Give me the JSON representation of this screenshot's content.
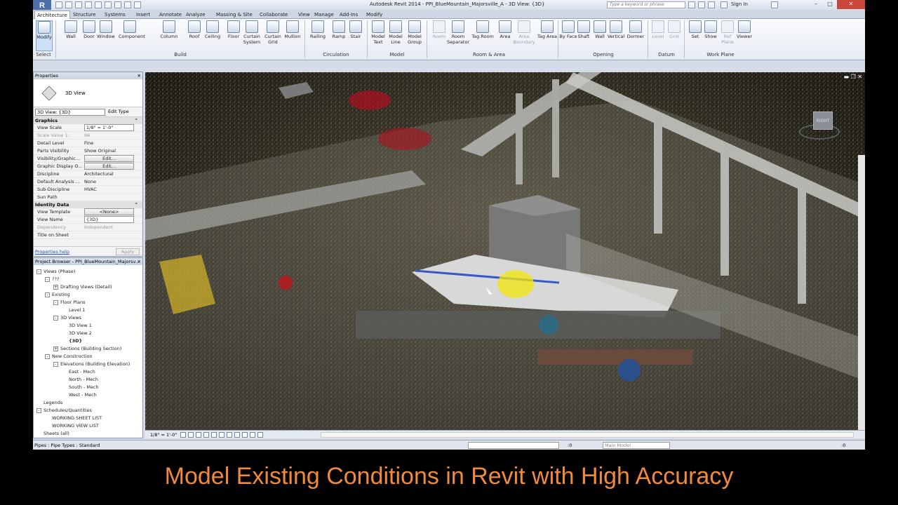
{
  "app": {
    "logo_letter": "R",
    "window_title": "Autodesk Revit 2014 -    PPI_BlueMountain_Majorsville_A - 3D View: {3D}",
    "search_placeholder": "Type a keyword or phrase",
    "sign_in": "Sign In"
  },
  "tabs": [
    "Architecture",
    "Structure",
    "Systems",
    "Insert",
    "Annotate",
    "Analyze",
    "Massing & Site",
    "Collaborate",
    "View",
    "Manage",
    "Add-Ins",
    "Modify"
  ],
  "ribbon": {
    "select_panel": {
      "button": "Modify",
      "label": "Select"
    },
    "build": {
      "buttons": [
        "Wall",
        "Door",
        "Window",
        "Component",
        "Column",
        "Roof",
        "Ceiling",
        "Floor",
        "Curtain System",
        "Curtain Grid",
        "Mullion"
      ],
      "label": "Build"
    },
    "circulation": {
      "buttons": [
        "Railing",
        "Ramp",
        "Stair"
      ],
      "label": "Circulation"
    },
    "model": {
      "buttons": [
        "Model Text",
        "Model Line",
        "Model Group"
      ],
      "label": "Model"
    },
    "room_area": {
      "buttons": [
        "Room",
        "Room Separator",
        "Tag Room",
        "Area",
        "Area Boundary",
        "Tag Area"
      ],
      "label": "Room & Area"
    },
    "opening": {
      "buttons": [
        "By Face",
        "Shaft",
        "Wall",
        "Vertical",
        "Dormer"
      ],
      "label": "Opening"
    },
    "datum": {
      "buttons": [
        "Level",
        "Grid"
      ],
      "label": "Datum"
    },
    "work_plane": {
      "buttons": [
        "Set",
        "Show",
        "Ref Plane",
        "Viewer"
      ],
      "label": "Work Plane"
    }
  },
  "properties": {
    "title": "Properties",
    "type_name": "3D View",
    "instance_selector": "3D View: {3D}",
    "edit_type": "Edit Type",
    "graphics_header": "Graphics",
    "rows": [
      {
        "k": "View Scale",
        "v": "1/8\" = 1'-0\""
      },
      {
        "k": "Scale Value    1:",
        "v": "96"
      },
      {
        "k": "Detail Level",
        "v": "Fine"
      },
      {
        "k": "Parts Visibility",
        "v": "Show Original"
      },
      {
        "k": "Visibility/Graphic...",
        "v": "Edit..."
      },
      {
        "k": "Graphic Display O...",
        "v": "Edit..."
      },
      {
        "k": "Discipline",
        "v": "Architectural"
      },
      {
        "k": "Default Analysis ...",
        "v": "None"
      },
      {
        "k": "Sub-Discipline",
        "v": "HVAC"
      },
      {
        "k": "Sun Path",
        "v": ""
      }
    ],
    "identity_header": "Identity Data",
    "identity_rows": [
      {
        "k": "View Template",
        "v": "<None>"
      },
      {
        "k": "View Name",
        "v": "{3D}"
      },
      {
        "k": "Dependency",
        "v": "Independent"
      },
      {
        "k": "Title on Sheet",
        "v": ""
      }
    ],
    "help_link": "Properties help",
    "apply": "Apply"
  },
  "browser": {
    "title": "Project Browser - PPI_BlueMountain_Majorsv...",
    "nodes": [
      {
        "t": "Views (Phase)",
        "d": 0,
        "tog": "-"
      },
      {
        "t": "???",
        "d": 1,
        "tog": "-"
      },
      {
        "t": "Drafting Views (Detail)",
        "d": 2,
        "tog": "+"
      },
      {
        "t": "Existing",
        "d": 1,
        "tog": "-"
      },
      {
        "t": "Floor Plans",
        "d": 2,
        "tog": "-"
      },
      {
        "t": "Level 1",
        "d": 3,
        "tog": ""
      },
      {
        "t": "3D Views",
        "d": 2,
        "tog": "-"
      },
      {
        "t": "3D View 1",
        "d": 3,
        "tog": ""
      },
      {
        "t": "3D View 2",
        "d": 3,
        "tog": ""
      },
      {
        "t": "{3D}",
        "d": 3,
        "tog": "",
        "bold": true
      },
      {
        "t": "Sections (Building Section)",
        "d": 2,
        "tog": "+"
      },
      {
        "t": "New Construction",
        "d": 1,
        "tog": "-"
      },
      {
        "t": "Elevations (Building Elevation)",
        "d": 2,
        "tog": "-"
      },
      {
        "t": "East - Mech",
        "d": 3,
        "tog": ""
      },
      {
        "t": "North - Mech",
        "d": 3,
        "tog": ""
      },
      {
        "t": "South - Mech",
        "d": 3,
        "tog": ""
      },
      {
        "t": "West - Mech",
        "d": 3,
        "tog": ""
      },
      {
        "t": "Legends",
        "d": 0,
        "tog": ""
      },
      {
        "t": "Schedules/Quantities",
        "d": 0,
        "tog": "-"
      },
      {
        "t": "WORKING SHEET LIST",
        "d": 1,
        "tog": ""
      },
      {
        "t": "WORKING VIEW LIST",
        "d": 1,
        "tog": ""
      },
      {
        "t": "Sheets (all)",
        "d": 0,
        "tog": ""
      }
    ]
  },
  "viewport": {
    "scale": "1/8\" = 1'-0\"",
    "cube_label": "RIGHT"
  },
  "status": {
    "text": "Pipes : Pipe Types : Standard",
    "zero1": ":0",
    "design_option": "Main Model",
    "zero2": ":0"
  },
  "caption": "Model Existing Conditions in Revit with High Accuracy"
}
